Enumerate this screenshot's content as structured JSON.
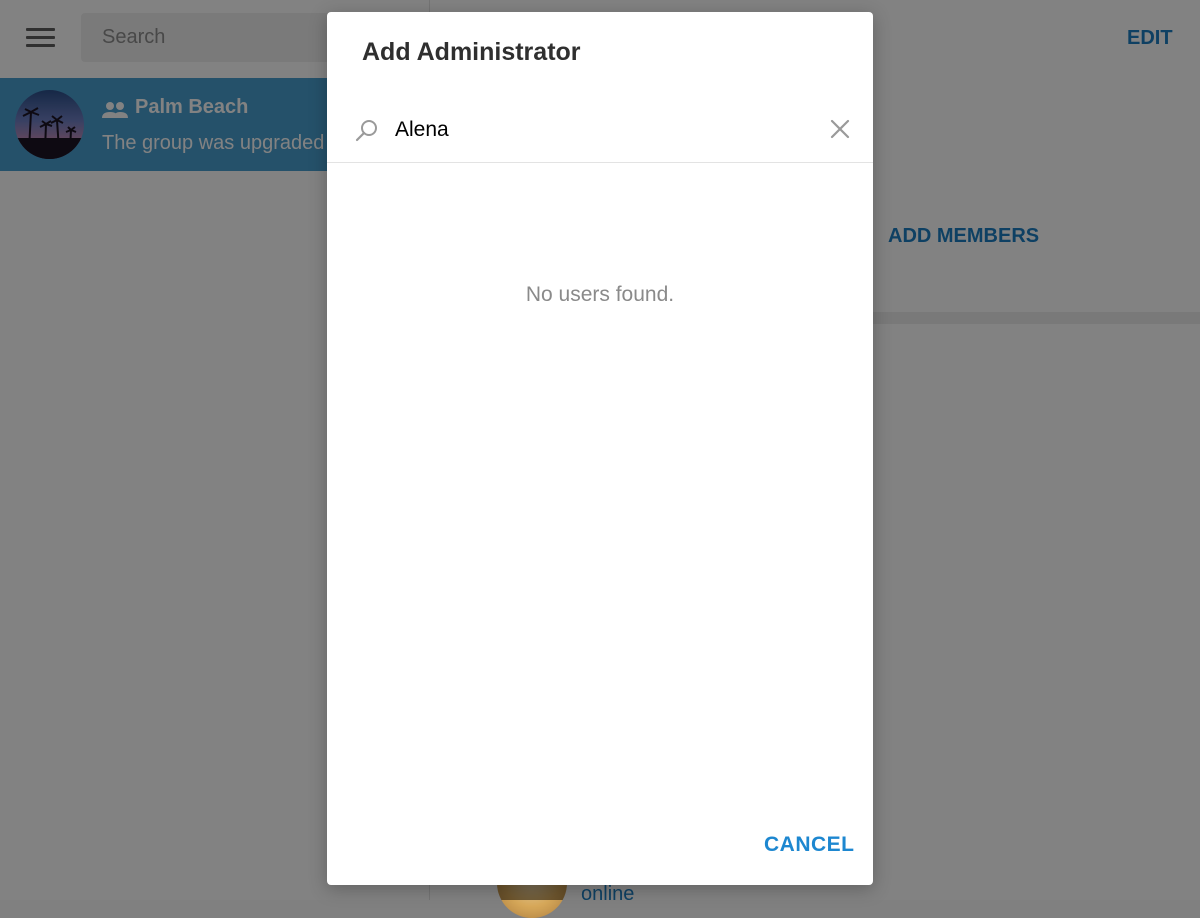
{
  "sidebar": {
    "search_placeholder": "Search",
    "chats": [
      {
        "title": "Palm Beach",
        "preview": "The group was upgraded",
        "type_icon": "group-icon",
        "selected": true
      }
    ]
  },
  "right_panel": {
    "edit_label": "EDIT",
    "add_members_label": "ADD MEMBERS",
    "member_status": "online"
  },
  "dialog": {
    "title": "Add Administrator",
    "search_value": "Alena",
    "search_icon": "search-icon",
    "clear_icon": "close-icon",
    "empty_message": "No users found.",
    "cancel_label": "CANCEL"
  },
  "colors": {
    "accent": "#1d87d0",
    "selected_chat_bg": "#4a9fd1",
    "overlay": "rgba(0,0,0,0.49)"
  }
}
